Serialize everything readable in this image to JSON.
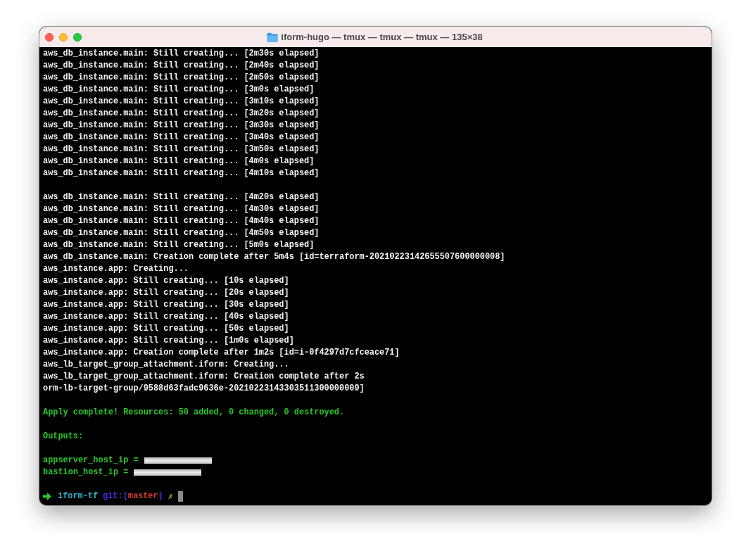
{
  "window": {
    "title": "iform-hugo — tmux — tmux — tmux — 135×38"
  },
  "terminal": {
    "lines": [
      {
        "kind": "output",
        "text": "aws_db_instance.main: Still creating... [2m30s elapsed]"
      },
      {
        "kind": "output",
        "text": "aws_db_instance.main: Still creating... [2m40s elapsed]"
      },
      {
        "kind": "output",
        "text": "aws_db_instance.main: Still creating... [2m50s elapsed]"
      },
      {
        "kind": "output",
        "text": "aws_db_instance.main: Still creating... [3m0s elapsed]"
      },
      {
        "kind": "output",
        "text": "aws_db_instance.main: Still creating... [3m10s elapsed]"
      },
      {
        "kind": "output",
        "text": "aws_db_instance.main: Still creating... [3m20s elapsed]"
      },
      {
        "kind": "output",
        "text": "aws_db_instance.main: Still creating... [3m30s elapsed]"
      },
      {
        "kind": "output",
        "text": "aws_db_instance.main: Still creating... [3m40s elapsed]"
      },
      {
        "kind": "output",
        "text": "aws_db_instance.main: Still creating... [3m50s elapsed]"
      },
      {
        "kind": "output",
        "text": "aws_db_instance.main: Still creating... [4m0s elapsed]"
      },
      {
        "kind": "output",
        "text": "aws_db_instance.main: Still creating... [4m10s elapsed]"
      },
      {
        "kind": "blank"
      },
      {
        "kind": "output",
        "text": "aws_db_instance.main: Still creating... [4m20s elapsed]"
      },
      {
        "kind": "output",
        "text": "aws_db_instance.main: Still creating... [4m30s elapsed]"
      },
      {
        "kind": "output",
        "text": "aws_db_instance.main: Still creating... [4m40s elapsed]"
      },
      {
        "kind": "output",
        "text": "aws_db_instance.main: Still creating... [4m50s elapsed]"
      },
      {
        "kind": "output",
        "text": "aws_db_instance.main: Still creating... [5m0s elapsed]"
      },
      {
        "kind": "output",
        "text": "aws_db_instance.main: Creation complete after 5m4s [id=terraform-20210223142655507600000008]"
      },
      {
        "kind": "output",
        "text": "aws_instance.app: Creating..."
      },
      {
        "kind": "output",
        "text": "aws_instance.app: Still creating... [10s elapsed]"
      },
      {
        "kind": "output",
        "text": "aws_instance.app: Still creating... [20s elapsed]"
      },
      {
        "kind": "output",
        "text": "aws_instance.app: Still creating... [30s elapsed]"
      },
      {
        "kind": "output",
        "text": "aws_instance.app: Still creating... [40s elapsed]"
      },
      {
        "kind": "output",
        "text": "aws_instance.app: Still creating... [50s elapsed]"
      },
      {
        "kind": "output",
        "text": "aws_instance.app: Still creating... [1m0s elapsed]"
      },
      {
        "kind": "output",
        "text": "aws_instance.app: Creation complete after 1m2s [id=i-0f4297d7cfceace71]"
      },
      {
        "kind": "output",
        "text": "aws_lb_target_group_attachment.iform: Creating..."
      },
      {
        "kind": "output",
        "text": "aws_lb_target_group_attachment.iform: Creation complete after 2s"
      },
      {
        "kind": "output",
        "text": "orm-lb-target-group/9588d63fadc9636e-20210223143303511300000009]"
      },
      {
        "kind": "blank"
      },
      {
        "kind": "success",
        "text": "Apply complete! Resources: 50 added, 0 changed, 0 destroyed."
      },
      {
        "kind": "blank"
      },
      {
        "kind": "success",
        "text": "Outputs:"
      },
      {
        "kind": "blank"
      },
      {
        "kind": "redacted_output",
        "text": "appserver_host_ip ="
      },
      {
        "kind": "redacted_output",
        "text": "bastion_host_ip ="
      },
      {
        "kind": "blank"
      }
    ],
    "prompt": {
      "directory": "iform-tf",
      "git_open": "git:(",
      "branch": "master",
      "git_close": ")",
      "dirty_mark": "✗",
      "cursor": true
    }
  }
}
